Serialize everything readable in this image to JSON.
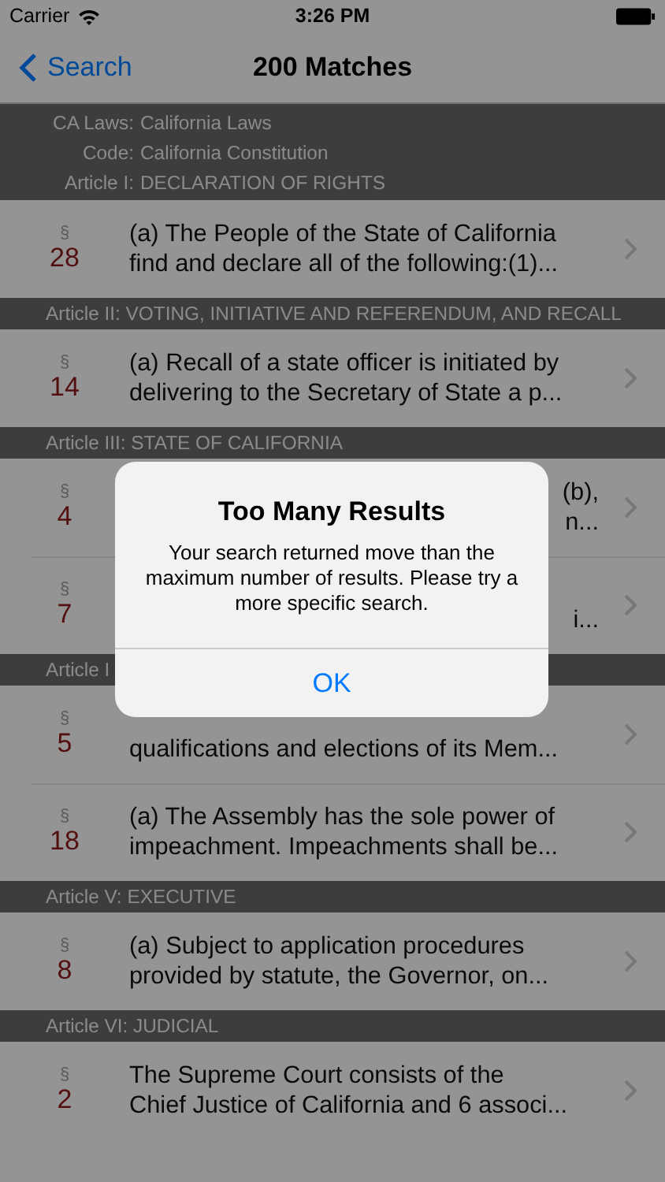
{
  "status_bar": {
    "carrier": "Carrier",
    "time": "3:26 PM"
  },
  "nav": {
    "back": "Search",
    "title": "200 Matches"
  },
  "sections": [
    {
      "header": {
        "kind": "aligned",
        "lines": [
          {
            "label": "CA Laws:",
            "value": "California Laws"
          },
          {
            "label": "Code:",
            "value": "California Constitution"
          },
          {
            "label": "Article I:",
            "value": "DECLARATION OF RIGHTS"
          }
        ]
      },
      "rows": [
        {
          "kind": "full",
          "symbol": "§",
          "number": "28",
          "lines": [
            "(a) The People of the State of California",
            "find and declare all of the following:(1)..."
          ]
        }
      ]
    },
    {
      "header": {
        "kind": "plain",
        "text": "Article II: VOTING, INITIATIVE AND REFERENDUM, AND RECALL"
      },
      "rows": [
        {
          "kind": "full",
          "symbol": "§",
          "number": "14",
          "lines": [
            "(a) Recall of a state officer is initiated by",
            "delivering to the Secretary of State a p..."
          ]
        }
      ]
    },
    {
      "header": {
        "kind": "plain",
        "text": "Article III: STATE OF CALIFORNIA"
      },
      "rows": [
        {
          "kind": "partial",
          "symbol": "§",
          "number": "4",
          "lines": [
            "(b),",
            "n..."
          ]
        },
        {
          "kind": "partial",
          "symbol": "§",
          "number": "7",
          "lines": [
            "i..."
          ]
        }
      ]
    },
    {
      "header": {
        "kind": "plain",
        "text": "Article I"
      },
      "rows": [
        {
          "kind": "lower",
          "symbol": "§",
          "number": "5",
          "lines": [
            "qualifications and elections of its Mem..."
          ]
        },
        {
          "kind": "full",
          "symbol": "§",
          "number": "18",
          "lines": [
            "(a) The Assembly has the sole power of",
            "impeachment. Impeachments shall be..."
          ]
        }
      ]
    },
    {
      "header": {
        "kind": "plain",
        "text": "Article V: EXECUTIVE"
      },
      "rows": [
        {
          "kind": "full",
          "symbol": "§",
          "number": "8",
          "lines": [
            "(a) Subject to application procedures",
            "provided by statute, the Governor, on..."
          ]
        }
      ]
    },
    {
      "header": {
        "kind": "plain",
        "text": "Article VI: JUDICIAL"
      },
      "rows": [
        {
          "kind": "full",
          "symbol": "§",
          "number": "2",
          "lines": [
            "The Supreme Court consists of the",
            "Chief Justice of California and 6 associ..."
          ]
        }
      ]
    }
  ],
  "alert": {
    "title": "Too Many Results",
    "message": "Your search returned move than the maximum number of results. Please try a more specific search.",
    "button": "OK"
  }
}
